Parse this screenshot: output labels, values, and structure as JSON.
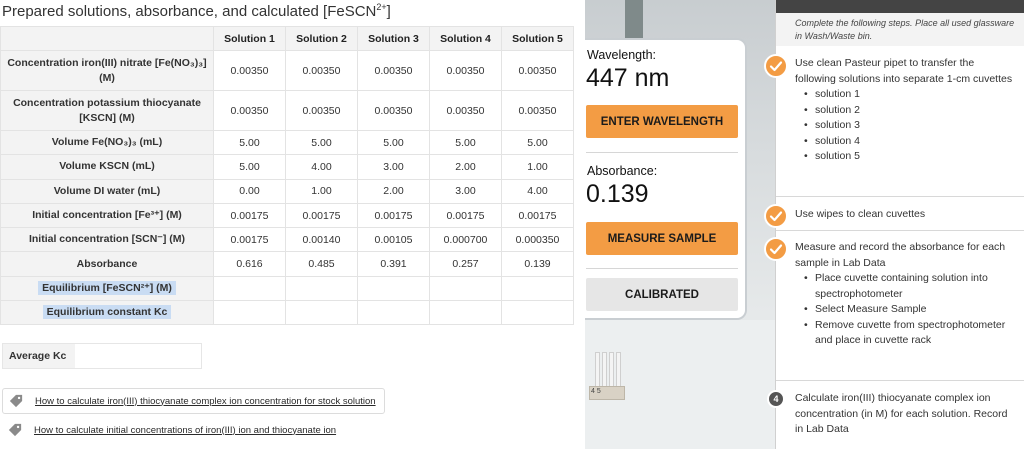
{
  "table": {
    "title": "Prepared solutions, absorbance, and calculated [FeSCN",
    "title_sup": "2+",
    "title_end": "]",
    "columns": [
      "Solution 1",
      "Solution 2",
      "Solution 3",
      "Solution 4",
      "Solution 5"
    ],
    "rows": [
      {
        "label": "Concentration iron(III) nitrate [Fe(NO₃)₃] (M)",
        "values": [
          "0.00350",
          "0.00350",
          "0.00350",
          "0.00350",
          "0.00350"
        ]
      },
      {
        "label": "Concentration potassium thiocyanate [KSCN] (M)",
        "values": [
          "0.00350",
          "0.00350",
          "0.00350",
          "0.00350",
          "0.00350"
        ]
      },
      {
        "label": "Volume Fe(NO₃)₃ (mL)",
        "values": [
          "5.00",
          "5.00",
          "5.00",
          "5.00",
          "5.00"
        ]
      },
      {
        "label": "Volume KSCN (mL)",
        "values": [
          "5.00",
          "4.00",
          "3.00",
          "2.00",
          "1.00"
        ]
      },
      {
        "label": "Volume DI water (mL)",
        "values": [
          "0.00",
          "1.00",
          "2.00",
          "3.00",
          "4.00"
        ]
      },
      {
        "label": "Initial concentration [Fe³⁺] (M)",
        "values": [
          "0.00175",
          "0.00175",
          "0.00175",
          "0.00175",
          "0.00175"
        ]
      },
      {
        "label": "Initial concentration [SCN⁻] (M)",
        "values": [
          "0.00175",
          "0.00140",
          "0.00105",
          "0.000700",
          "0.000350"
        ]
      },
      {
        "label": "Absorbance",
        "values": [
          "0.616",
          "0.485",
          "0.391",
          "0.257",
          "0.139"
        ]
      },
      {
        "label": "Equilibrium [FeSCN²⁺] (M)",
        "values": [
          "",
          "",
          "",
          "",
          ""
        ]
      },
      {
        "label": "Equilibrium constant Kc",
        "values": [
          "",
          "",
          "",
          "",
          ""
        ]
      }
    ],
    "average_label": "Average Kc",
    "average_value": ""
  },
  "links": [
    "How to calculate iron(III) thiocyanate complex ion concentration for stock solution",
    "How to calculate initial concentrations of iron(III) ion and thiocyanate ion"
  ],
  "device": {
    "wavelength_label": "Wavelength:",
    "wavelength_value": "447 nm",
    "enter_button": "ENTER WAVELENGTH",
    "absorbance_label": "Absorbance:",
    "absorbance_value": "0.139",
    "measure_button": "MEASURE SAMPLE",
    "calibrated_button": "CALIBRATED",
    "rack_numbers": "4 5"
  },
  "procedure": {
    "note": "Complete the following steps. Place all used glassware in Wash/Waste bin.",
    "step1_text": "Use clean Pasteur pipet to transfer the following solutions into separate 1-cm cuvettes",
    "step1_items": [
      "solution 1",
      "solution 2",
      "solution 3",
      "solution 4",
      "solution 5"
    ],
    "step2_text": "Use wipes to clean cuvettes",
    "step3_text": "Measure and record the absorbance for each sample in Lab Data",
    "step3_items": [
      "Place cuvette containing solution into spectrophotometer",
      "Select Measure Sample",
      "Remove cuvette from spectrophotometer and place in cuvette rack"
    ],
    "step4_number": "4",
    "step4_text": "Calculate iron(III) thiocyanate complex ion concentration (in M) for each solution. Record in Lab Data"
  },
  "colors": {
    "accent": "#f39c44",
    "highlight": "#c9dcf3",
    "header_gray": "#f3f3f3"
  },
  "icons": [
    "tag-icon",
    "check-icon"
  ]
}
